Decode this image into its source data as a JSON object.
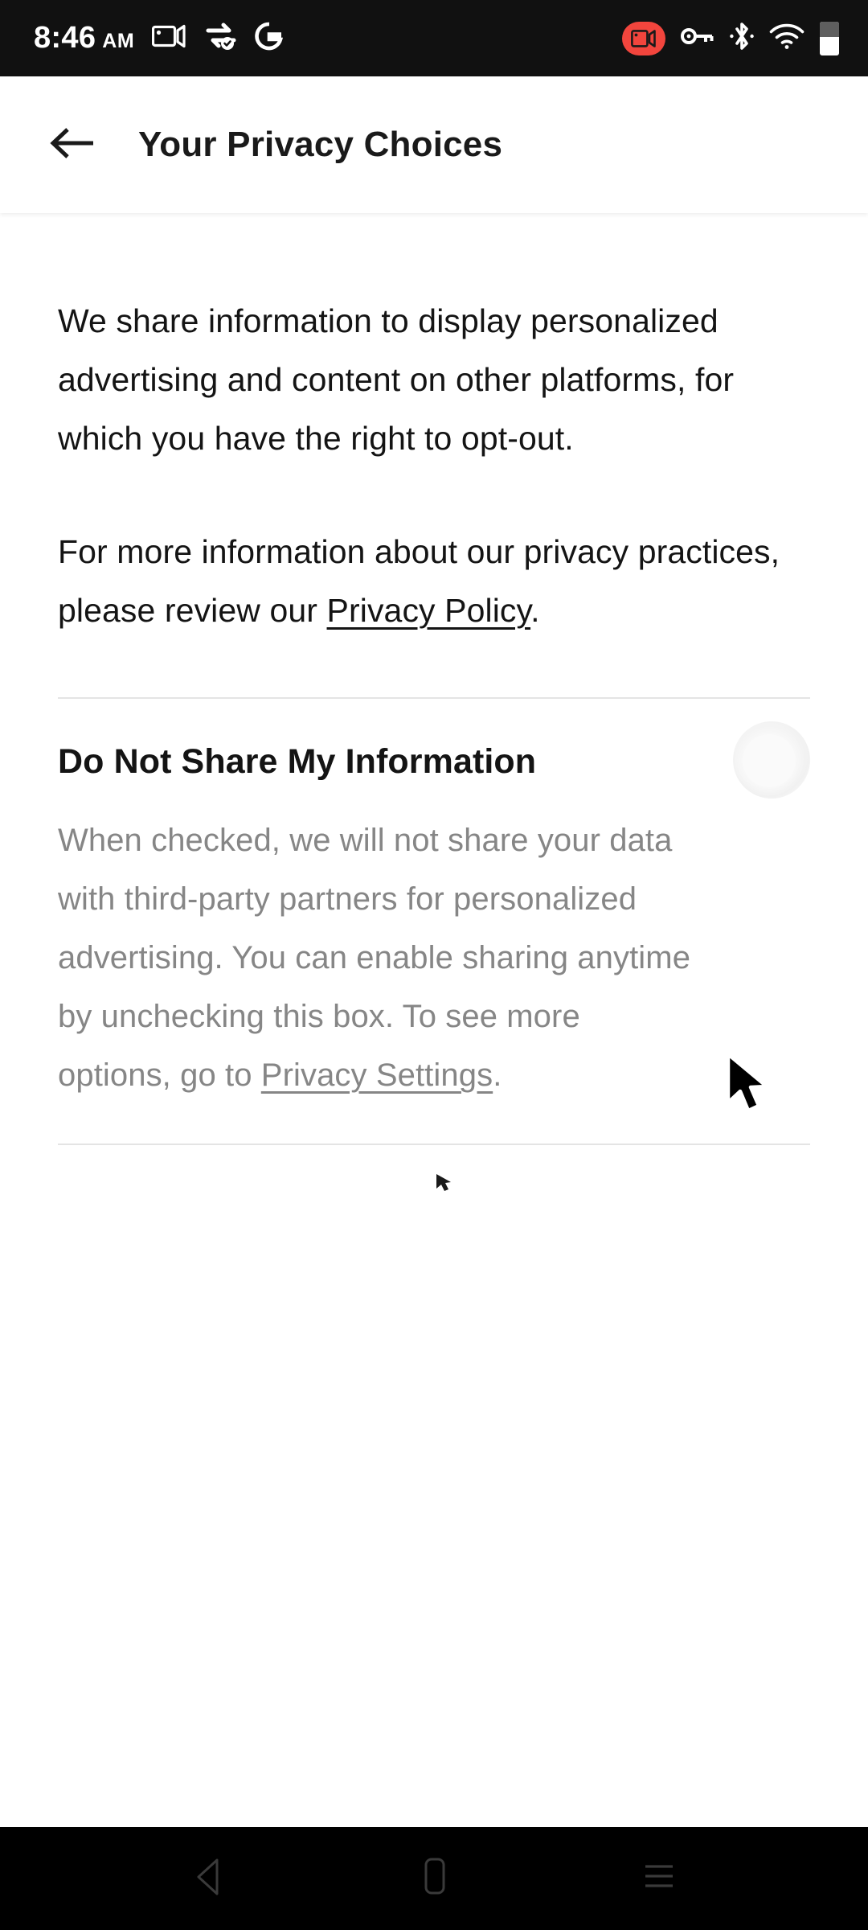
{
  "status_bar": {
    "time": "8:46",
    "ampm": "AM",
    "left_icons": [
      {
        "name": "screen-record-video-icon"
      },
      {
        "name": "data-sync-check-icon"
      },
      {
        "name": "google-g-icon"
      }
    ],
    "right_icons": [
      {
        "name": "screen-recording-active-icon",
        "color": "#f2453d"
      },
      {
        "name": "vpn-key-icon"
      },
      {
        "name": "bluetooth-icon"
      },
      {
        "name": "wifi-icon"
      },
      {
        "name": "battery-icon"
      }
    ],
    "background_color": "#111111"
  },
  "app_bar": {
    "back_icon": "arrow-left-icon",
    "title": "Your Privacy Choices"
  },
  "content": {
    "paragraph_1": "We share information to display personalized advertising and content on other platforms, for which you have the right to opt-out.",
    "paragraph_2_prefix": "For more information about our privacy practices, please review our ",
    "privacy_policy_link": "Privacy Policy",
    "paragraph_2_suffix": ".",
    "section": {
      "title": "Do Not Share My Information",
      "checkbox_name": "do-not-share-my-information-checkbox",
      "checkbox_checked": false,
      "description_prefix": "When checked, we will not share your data with third-party partners for personalized advertising. You can enable sharing anytime by unchecking this box. To see more options, go to ",
      "privacy_settings_link": "Privacy Settings",
      "description_suffix": "."
    }
  },
  "nav_bar": {
    "back_label": "back-triangle-icon",
    "home_label": "home-square-icon",
    "recents_label": "recents-lines-icon",
    "background_color": "#000000"
  },
  "colors": {
    "text_primary": "#141414",
    "text_secondary": "#868686",
    "divider": "#e4e4e4",
    "page_background": "#ffffff",
    "accent_record": "#f2453d"
  }
}
